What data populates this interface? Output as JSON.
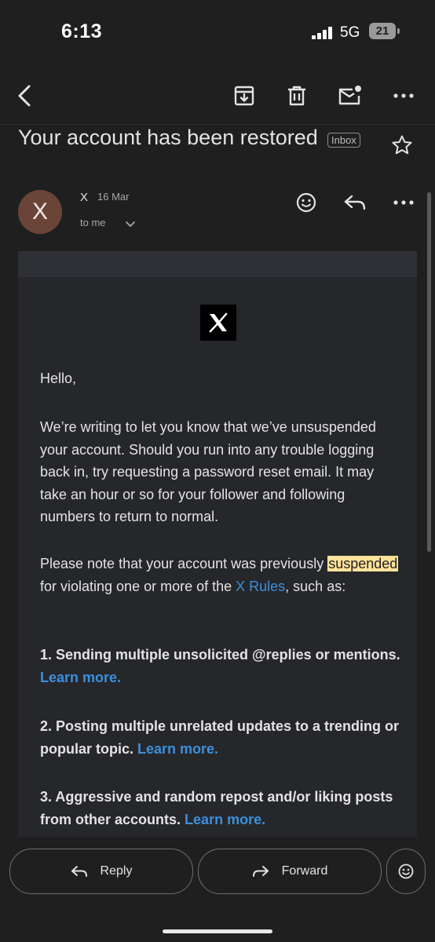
{
  "status_bar": {
    "time": "6:13",
    "network": "5G",
    "battery": "21"
  },
  "toolbar": {
    "back_icon": "back-arrow-icon",
    "archive_icon": "archive-icon",
    "delete_icon": "trash-icon",
    "mark_unread_icon": "mail-unread-icon",
    "more_icon": "more-horizontal-icon"
  },
  "email": {
    "subject": "Your account has been restored",
    "label": "Inbox",
    "sender": {
      "avatar_letter": "X",
      "avatar_color": "#6b4438",
      "name": "X",
      "date": "16 Mar",
      "recipient": "to me"
    },
    "body": {
      "greeting": "Hello,",
      "paragraph1": "We’re writing to let you know that we’ve unsuspended your account. Should you run into any trouble logging back in, try requesting a password reset email. It may take an hour or so for your follower and following numbers to return to normal.",
      "paragraph2_before": "Please note that your account was previously ",
      "paragraph2_highlight": "suspended",
      "paragraph2_middle": " for violating one or more of the ",
      "paragraph2_link": "X Rules",
      "paragraph2_after": ", such as:",
      "items": [
        {
          "text": "1. Sending multiple unsolicited @replies or mentions.",
          "link": "Learn more."
        },
        {
          "text": "2. Posting multiple unrelated updates to a trending or popular topic.",
          "link": "Learn more."
        },
        {
          "text": "3. Aggressive and random repost and/or liking posts from other accounts.",
          "link": "Learn more."
        }
      ]
    }
  },
  "actions": {
    "reply_label": "Reply",
    "forward_label": "Forward"
  },
  "colors": {
    "background": "#1f1f1f",
    "link": "#3c8fdc",
    "highlight": "#ffe29a"
  }
}
